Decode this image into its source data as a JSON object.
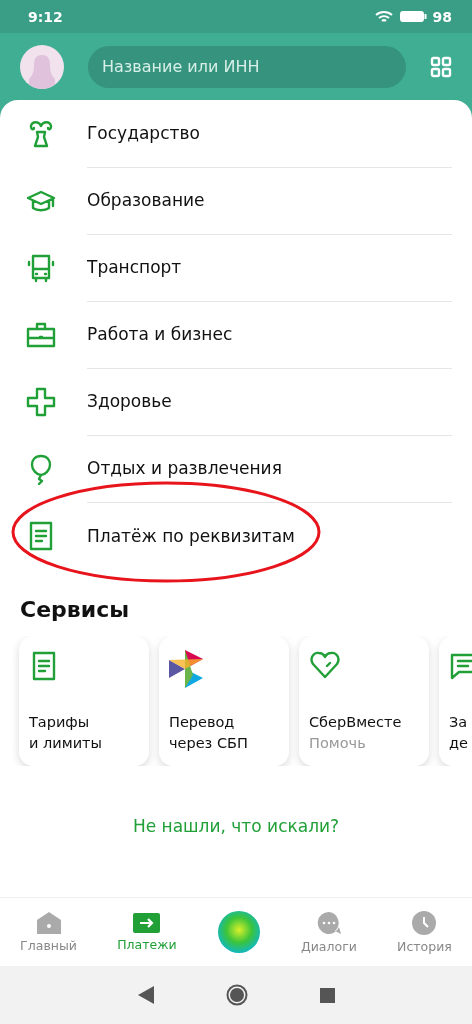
{
  "status_bar": {
    "time": "9:12",
    "battery": "98"
  },
  "search": {
    "placeholder": "Название или ИНН"
  },
  "categories": [
    {
      "kind": "government",
      "label": "Государство"
    },
    {
      "kind": "education",
      "label": "Образование"
    },
    {
      "kind": "transport",
      "label": "Транспорт"
    },
    {
      "kind": "work",
      "label": "Работа и бизнес"
    },
    {
      "kind": "health",
      "label": "Здоровье"
    },
    {
      "kind": "leisure",
      "label": "Отдых и развлечения"
    },
    {
      "kind": "document",
      "label": "Платёж по реквизитам"
    }
  ],
  "services": {
    "title": "Сервисы",
    "cards": [
      {
        "kind": "document",
        "lines": [
          "Тарифы",
          "и лимиты"
        ]
      },
      {
        "kind": "sbp",
        "lines": [
          "Перевод",
          "через СБП"
        ]
      },
      {
        "kind": "heart",
        "lines": [
          "СберВместе"
        ],
        "subtitle": "Помочь"
      },
      {
        "kind": "chat",
        "lines": [
          "За",
          "де"
        ]
      }
    ]
  },
  "help_link": "Не нашли, что искали?",
  "tabs": [
    {
      "kind": "home",
      "label": "Главный",
      "selected": false
    },
    {
      "kind": "payments",
      "label": "Платежи",
      "selected": true
    },
    {
      "kind": "assistant",
      "selected": false
    },
    {
      "kind": "dialogs",
      "label": "Диалоги",
      "selected": false
    },
    {
      "kind": "history",
      "label": "История",
      "selected": false
    }
  ]
}
